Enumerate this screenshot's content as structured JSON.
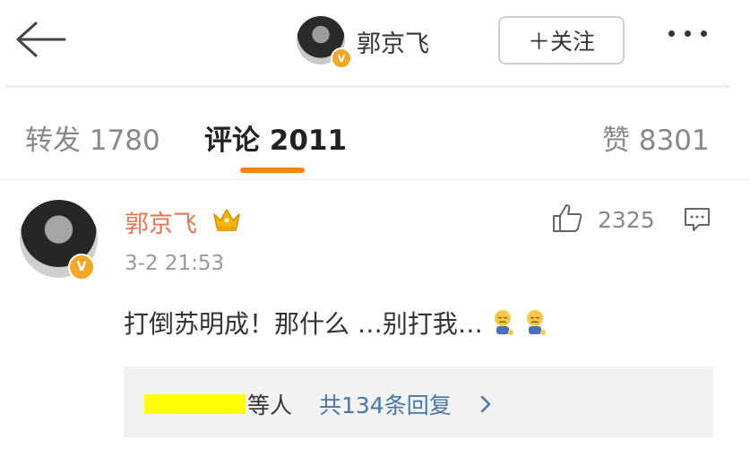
{
  "header": {
    "name": "郭京飞",
    "follow_label": "＋关注"
  },
  "tabs": {
    "repost": "转发 1780",
    "comment": "评论 2011",
    "like": "赞 8301"
  },
  "comment": {
    "author": "郭京飞",
    "time": "3-2 21:53",
    "likes": "2325",
    "text": "打倒苏明成！那什么 …别打我…",
    "verified_badge": "V"
  },
  "replies": {
    "users_suffix": "等人",
    "count_label": "共134条回复"
  },
  "colors": {
    "accent": "#ff8200",
    "name": "#eb7350",
    "link": "#4a76a8",
    "badge": "#f5a623",
    "redaction": "#ffff00"
  }
}
